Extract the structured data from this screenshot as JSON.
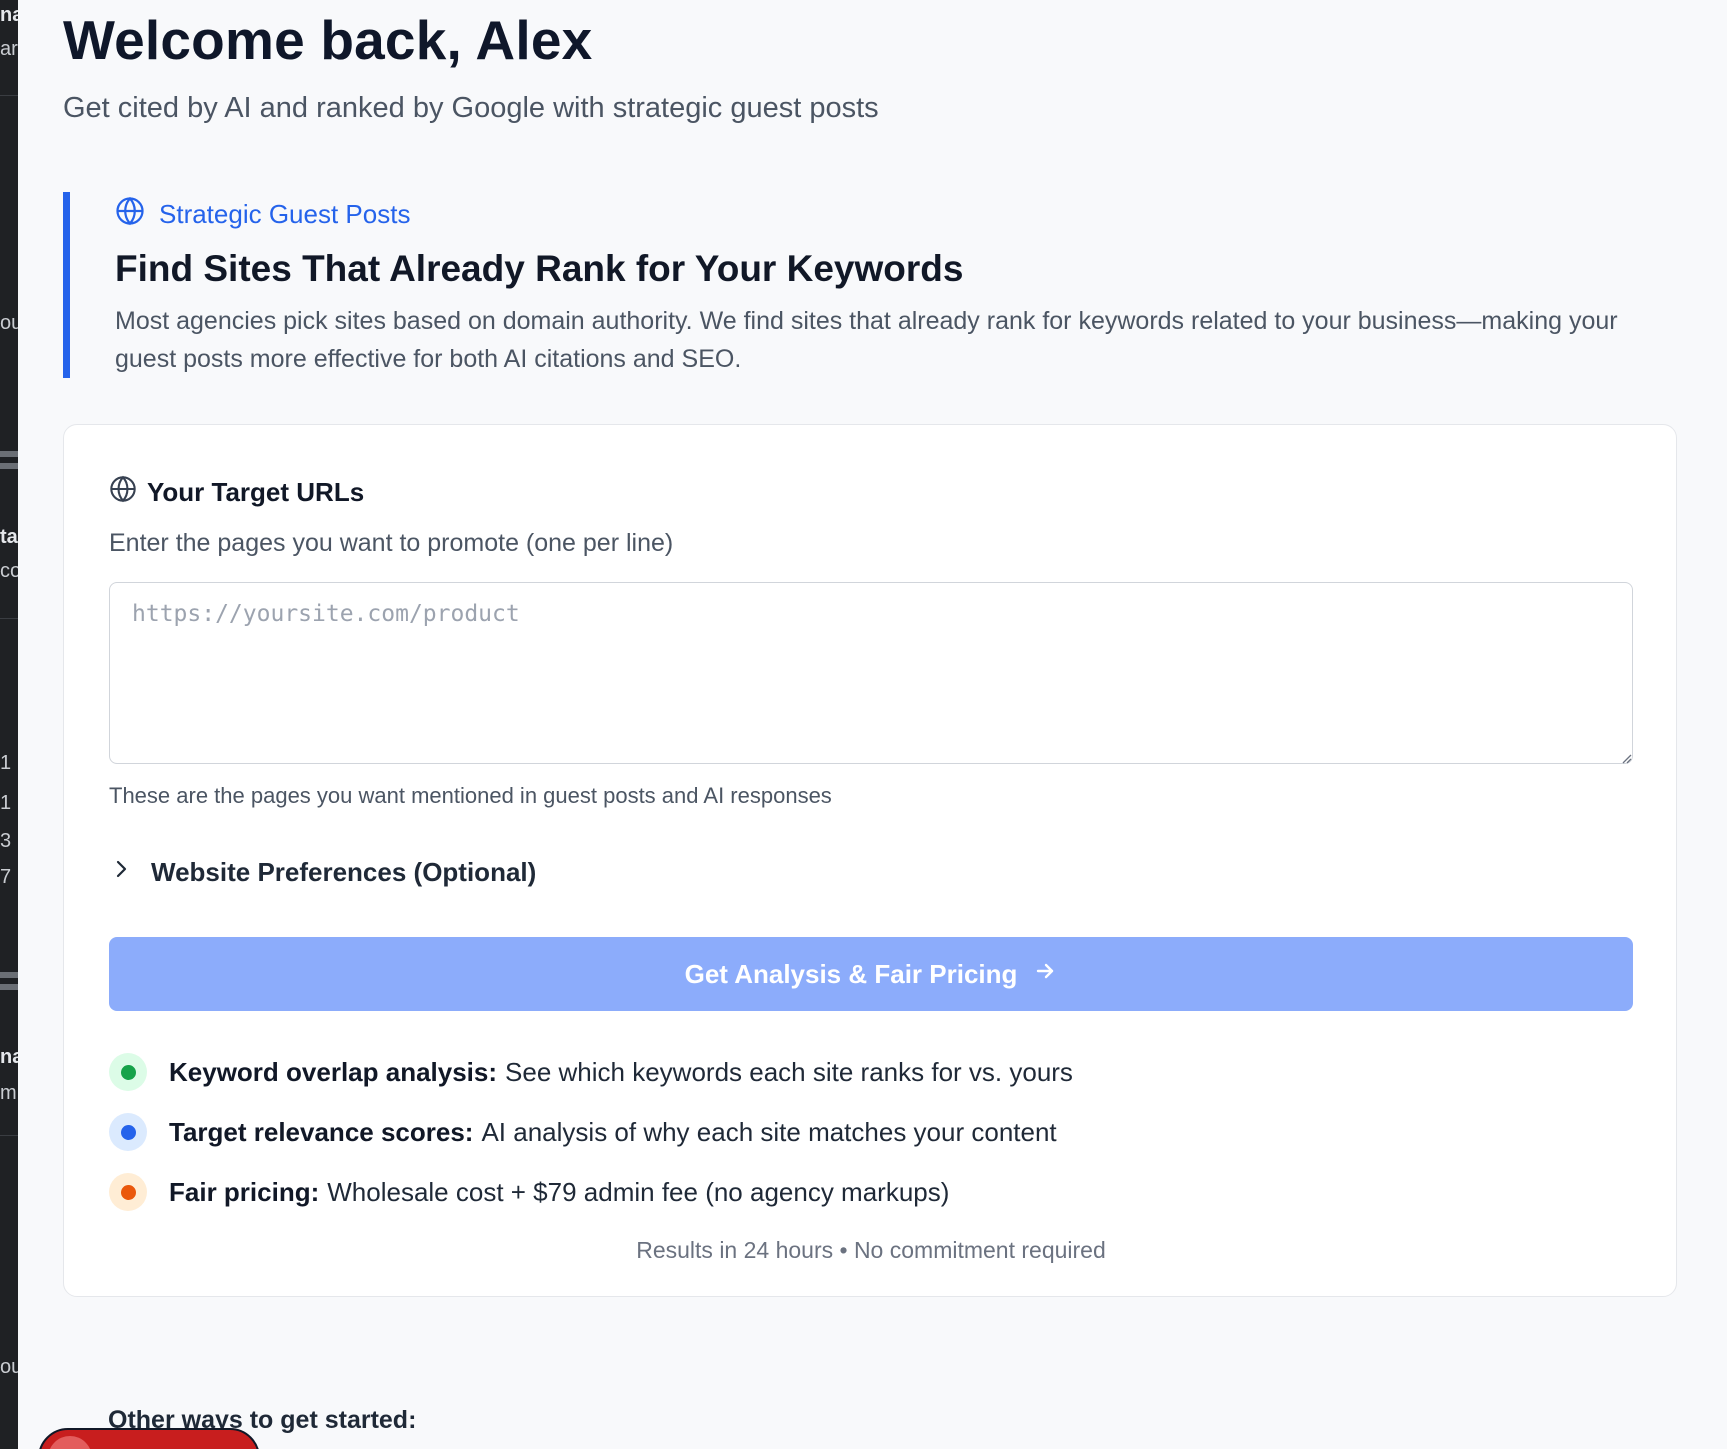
{
  "page": {
    "welcome": "Welcome back, Alex",
    "subtitle": "Get cited by AI and ranked by Google with strategic guest posts"
  },
  "callout": {
    "tag": "Strategic Guest Posts",
    "title": "Find Sites That Already Rank for Your Keywords",
    "description": "Most agencies pick sites based on domain authority. We find sites that already rank for keywords related to your business—making your guest posts more effective for both AI citations and SEO."
  },
  "card": {
    "header": "Your Target URLs",
    "instruction": "Enter the pages you want to promote (one per line)",
    "url_input": {
      "value": "",
      "placeholder": "https://yoursite.com/product"
    },
    "help": "These are the pages you want mentioned in guest posts and AI responses",
    "preferences_label": "Website Preferences (Optional)",
    "cta_label": "Get Analysis & Fair Pricing",
    "features": [
      {
        "title": "Keyword overlap analysis:",
        "text": "See which keywords each site ranks for vs. yours",
        "color": "#16a34a",
        "bg": "#dcfce7"
      },
      {
        "title": "Target relevance scores:",
        "text": "AI analysis of why each site matches your content",
        "color": "#2563eb",
        "bg": "#dbeafe"
      },
      {
        "title": "Fair pricing:",
        "text": "Wholesale cost + $79 admin fee (no agency markups)",
        "color": "#ea580c",
        "bg": "#ffedd5"
      }
    ],
    "footnote": "Results in 24 hours • No commitment required"
  },
  "other_ways": "Other ways to get started:",
  "left_strip_fragments": [
    "na",
    "ar",
    "ou",
    "ta",
    "co",
    "1",
    "1",
    "3",
    "7",
    "na",
    "m",
    "ou"
  ],
  "colors": {
    "accent": "#2563eb",
    "cta_bg": "#8cacfb",
    "page_bg": "#f8f9fb"
  }
}
